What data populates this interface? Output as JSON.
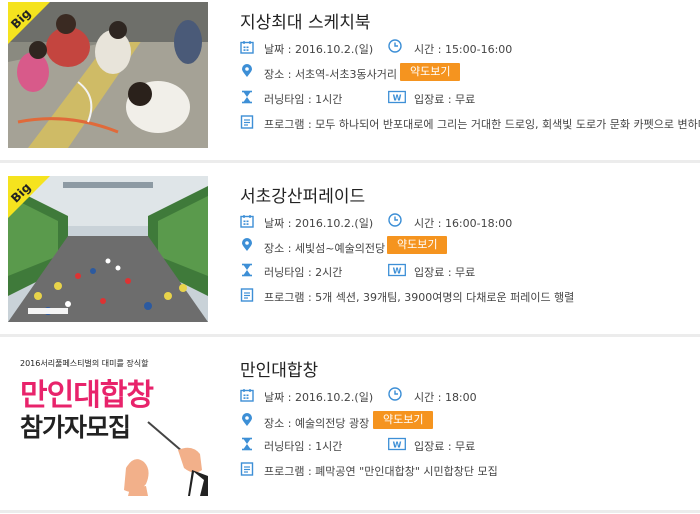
{
  "events": [
    {
      "big": true,
      "big_label": "Big",
      "title": "지상최대 스케치북",
      "date": "날짜 : 2016.10.2.(일)",
      "time": "시간 : 15:00-16:00",
      "place": "장소 : 서초역-서초3동사거리",
      "map_label": "약도보기",
      "runtime": "러닝타임 : 1시간",
      "fee": "입장료 : 무료",
      "program": "프로그램 : 모두 하나되어 반포대로에 그리는 거대한 드로잉, 회색빛 도로가 문화 카펫으로 변하다"
    },
    {
      "big": true,
      "big_label": "Big",
      "title": "서초강산퍼레이드",
      "date": "날짜 : 2016.10.2.(일)",
      "time": "시간 : 16:00-18:00",
      "place": "장소 : 세빛섬~예술의전당",
      "map_label": "약도보기",
      "runtime": "러닝타임 : 2시간",
      "fee": "입장료 : 무료",
      "program": "프로그램 : 5개 섹션, 39개팀, 3900여명의 다채로운 퍼레이드 행렬"
    },
    {
      "big": false,
      "title": "만인대합창",
      "poster_top": "2016서리풀페스티벌의 대미를 장식할",
      "poster_main": "만인대합창",
      "poster_sub": "참가자모집",
      "date": "날짜 : 2016.10.2.(일)",
      "time": "시간 : 18:00",
      "place": "장소 : 예술의전당 광장",
      "map_label": "약도보기",
      "runtime": "러닝타임 : 1시간",
      "fee": "입장료 : 무료",
      "program": "프로그램 : 폐막공연 \"만인대합창\" 시민합창단 모집"
    }
  ],
  "colors": {
    "accent_blue": "#3d8fd6",
    "badge_orange": "#f5941f",
    "big_yellow": "#f5e31e",
    "poster_pink": "#e8236b"
  },
  "icons": [
    "calendar-icon",
    "clock-icon",
    "location-pin-icon",
    "hourglass-icon",
    "won-ticket-icon",
    "program-list-icon"
  ]
}
